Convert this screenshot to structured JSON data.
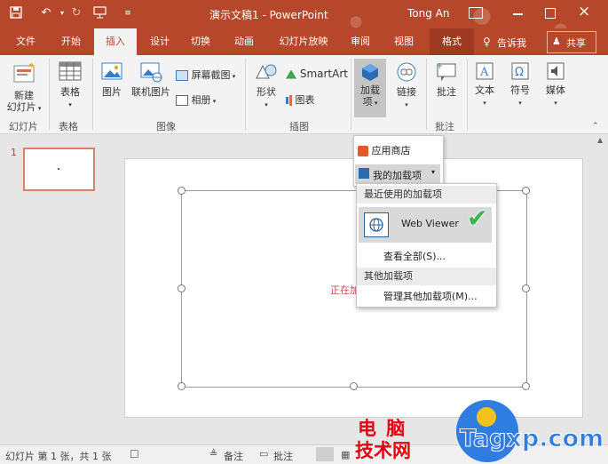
{
  "titlebar": {
    "doc_title": "演示文稿1 - PowerPoint",
    "user": "Tong An"
  },
  "tabs": [
    "文件",
    "开始",
    "插入",
    "设计",
    "切换",
    "动画",
    "幻灯片放映",
    "审阅",
    "视图",
    "格式"
  ],
  "tell_me": "告诉我",
  "share": "共享",
  "ribbon": {
    "new_slide": "新建\n幻灯片",
    "table": "表格",
    "picture": "图片",
    "online_picture": "联机图片",
    "screenshot": "屏幕截图",
    "album": "相册",
    "shapes": "形状",
    "smartart": "SmartArt",
    "chart": "图表",
    "addins": "加载\n项",
    "link": "链接",
    "comment": "批注",
    "text": "文本",
    "symbol": "符号",
    "media": "媒体",
    "groups": [
      "幻灯片",
      "表格",
      "图像",
      "插图",
      "批注"
    ]
  },
  "thumb": {
    "number": "1"
  },
  "slide": {
    "placeholder": "正在加"
  },
  "menu": {
    "store": "应用商店",
    "my_addins": "我的加载项",
    "recent_header": "最近使用的加载项",
    "web_viewer": "Web Viewer",
    "view_all": "查看全部(S)...",
    "other_header": "其他加载项",
    "manage": "管理其他加载项(M)..."
  },
  "statusbar": {
    "slide_info": "幻灯片 第 1 张，共 1 张",
    "notes": "备注",
    "comments": "批注"
  },
  "watermark": {
    "line1": "电 脑",
    "line2": "技术网",
    "site": "Tagxp.com"
  },
  "colors": {
    "accent": "#b7472a",
    "ribbon": "#f3f3f3"
  }
}
